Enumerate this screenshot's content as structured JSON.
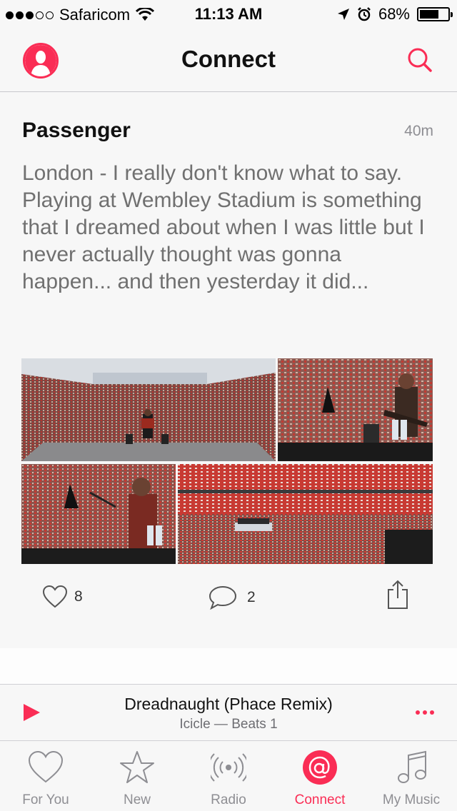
{
  "status_bar": {
    "carrier": "Safaricom",
    "time": "11:13 AM",
    "battery": "68%",
    "battery_level": 0.68,
    "signal_bars_filled": 3,
    "signal_bars_total": 5
  },
  "nav": {
    "title": "Connect",
    "profile_icon": "profile-icon",
    "search_icon": "search-icon"
  },
  "post": {
    "author": "Passenger",
    "time": "40m",
    "text": "London - I really don't know what to say. Playing at Wembley Stadium is something that I dreamed about when I was little but I never actually thought was gonna happen... and then yesterday it did...",
    "likes": "8",
    "comments": "2"
  },
  "mini_player": {
    "title": "Dreadnaught (Phace Remix)",
    "subtitle": "Icicle — Beats 1"
  },
  "tabs": [
    {
      "label": "For You",
      "icon": "heart-icon"
    },
    {
      "label": "New",
      "icon": "star-icon"
    },
    {
      "label": "Radio",
      "icon": "radio-icon"
    },
    {
      "label": "Connect",
      "icon": "connect-at-icon"
    },
    {
      "label": "My Music",
      "icon": "music-note-icon"
    }
  ],
  "colors": {
    "accent": "#fa2d55",
    "background": "#f7f7f7",
    "text_secondary": "#707070"
  }
}
